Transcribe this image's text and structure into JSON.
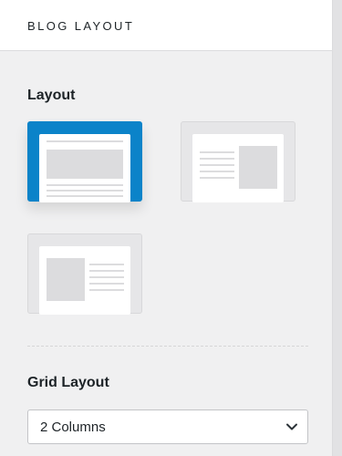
{
  "panel": {
    "title": "BLOG LAYOUT"
  },
  "layout": {
    "label": "Layout",
    "options": [
      {
        "name": "image-top",
        "selected": true
      },
      {
        "name": "image-right",
        "selected": false
      },
      {
        "name": "image-left",
        "selected": false
      }
    ]
  },
  "grid": {
    "label": "Grid Layout",
    "selected": "2 Columns"
  },
  "colors": {
    "accent": "#0b83c9",
    "background": "#f0f0f1"
  }
}
